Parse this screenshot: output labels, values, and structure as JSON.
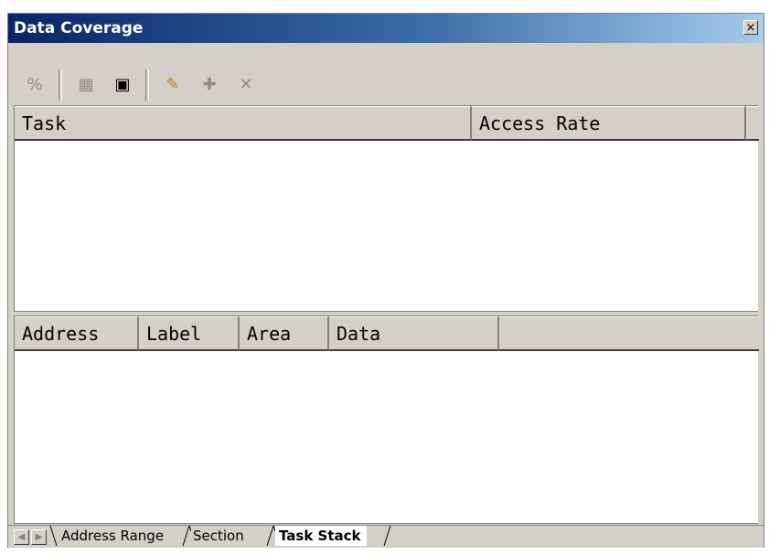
{
  "window": {
    "title": "Data Coverage",
    "close_label": "×"
  },
  "toolbar": {
    "buttons": [
      {
        "icon": "percent-icon",
        "glyph": "%",
        "enabled": false
      },
      {
        "icon": "coverage-graph-icon",
        "glyph": "▦",
        "enabled": false
      },
      {
        "icon": "memory-map-icon",
        "glyph": "▣",
        "enabled": true
      },
      {
        "icon": "highlight-icon",
        "glyph": "✎",
        "enabled": true
      },
      {
        "icon": "add-node-icon",
        "glyph": "✚",
        "enabled": false
      },
      {
        "icon": "remove-node-icon",
        "glyph": "✕",
        "enabled": false
      }
    ]
  },
  "task_table": {
    "columns": [
      "Task",
      "Access Rate",
      ""
    ]
  },
  "detail_table": {
    "columns": [
      "Address",
      "Label",
      "Area",
      "Data",
      ""
    ]
  },
  "tabs": {
    "items": [
      "Address Range",
      "Section",
      "Task Stack"
    ],
    "active": "Task Stack"
  },
  "colors": {
    "titlebar_start": "#0a246a",
    "titlebar_end": "#a6caf0",
    "face": "#d4d0c8"
  }
}
